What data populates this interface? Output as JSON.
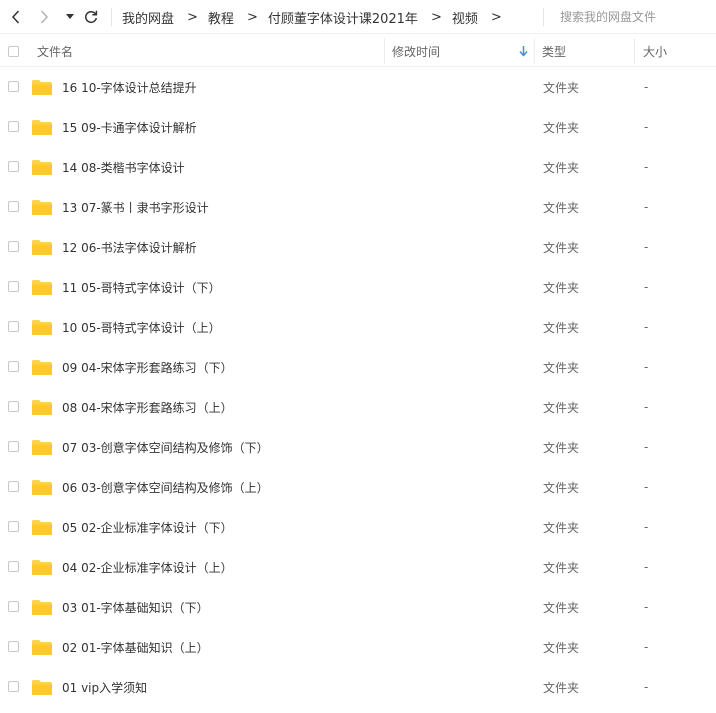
{
  "toolbar": {
    "breadcrumb": [
      "我的网盘",
      "教程",
      "付顾董字体设计课2021年",
      "视频"
    ],
    "breadcrumb_separator": ">",
    "search_placeholder": "搜索我的网盘文件"
  },
  "header": {
    "name": "文件名",
    "modified": "修改时间",
    "type": "类型",
    "size": "大小"
  },
  "colors": {
    "folder": "#FFD34E",
    "sort_arrow": "#3a8ee6",
    "text": "#333333",
    "muted": "#666666"
  },
  "rows": [
    {
      "name": "16 10-字体设计总结提升",
      "type": "文件夹",
      "size": "-"
    },
    {
      "name": "15 09-卡通字体设计解析",
      "type": "文件夹",
      "size": "-"
    },
    {
      "name": "14 08-类楷书字体设计",
      "type": "文件夹",
      "size": "-"
    },
    {
      "name": "13 07-篆书丨隶书字形设计",
      "type": "文件夹",
      "size": "-"
    },
    {
      "name": "12 06-书法字体设计解析",
      "type": "文件夹",
      "size": "-"
    },
    {
      "name": "11 05-哥特式字体设计（下）",
      "type": "文件夹",
      "size": "-"
    },
    {
      "name": "10 05-哥特式字体设计（上）",
      "type": "文件夹",
      "size": "-"
    },
    {
      "name": "09 04-宋体字形套路练习（下）",
      "type": "文件夹",
      "size": "-"
    },
    {
      "name": "08 04-宋体字形套路练习（上）",
      "type": "文件夹",
      "size": "-"
    },
    {
      "name": "07 03-创意字体空间结构及修饰（下）",
      "type": "文件夹",
      "size": "-"
    },
    {
      "name": "06 03-创意字体空间结构及修饰（上）",
      "type": "文件夹",
      "size": "-"
    },
    {
      "name": "05 02-企业标准字体设计（下）",
      "type": "文件夹",
      "size": "-"
    },
    {
      "name": "04 02-企业标准字体设计（上）",
      "type": "文件夹",
      "size": "-"
    },
    {
      "name": "03 01-字体基础知识（下）",
      "type": "文件夹",
      "size": "-"
    },
    {
      "name": "02 01-字体基础知识（上）",
      "type": "文件夹",
      "size": "-"
    },
    {
      "name": "01 vip入学须知",
      "type": "文件夹",
      "size": "-"
    }
  ]
}
